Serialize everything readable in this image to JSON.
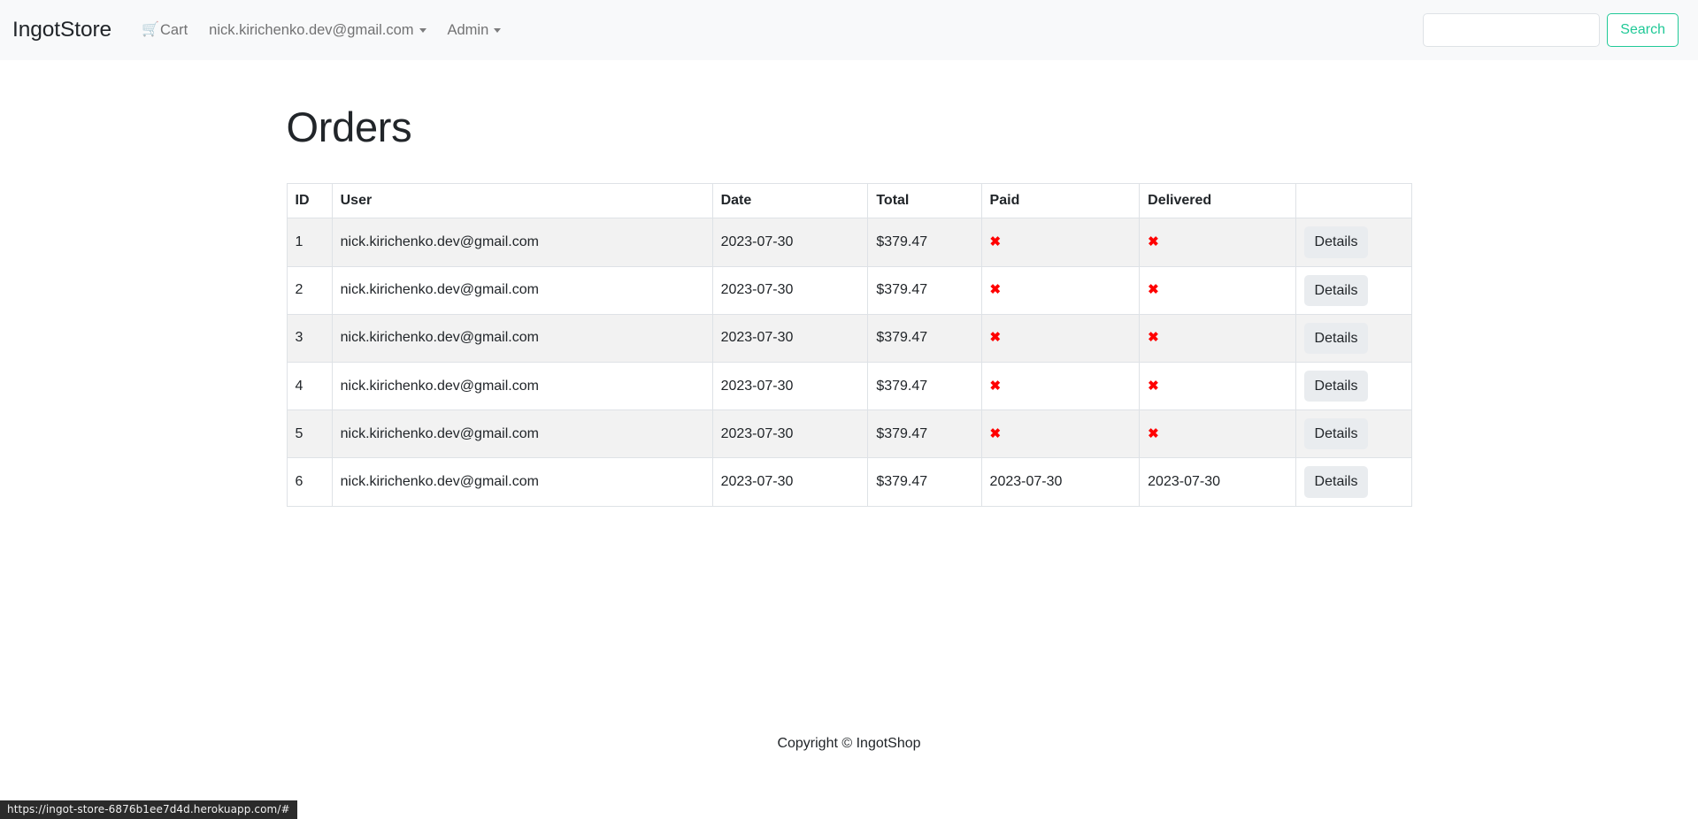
{
  "navbar": {
    "brand": "IngotStore",
    "links": [
      {
        "label": "Cart",
        "icon": "shopping-cart-icon",
        "has_caret": false
      },
      {
        "label": "nick.kirichenko.dev@gmail.com",
        "icon": null,
        "has_caret": true
      },
      {
        "label": "Admin",
        "icon": null,
        "has_caret": true
      }
    ],
    "search": {
      "value": "",
      "placeholder": "",
      "button_label": "Search",
      "accent_color": "#20c997"
    },
    "background_color": "#f8f9fa"
  },
  "main": {
    "title": "Orders",
    "table": {
      "columns": [
        "ID",
        "User",
        "Date",
        "Total",
        "Paid",
        "Delivered",
        ""
      ],
      "rows": [
        {
          "id": "1",
          "user": "nick.kirichenko.dev@gmail.com",
          "date": "2023-07-30",
          "total": "$379.47",
          "paid": "✖",
          "paid_is_date": false,
          "delivered": "✖",
          "delivered_is_date": false,
          "action": "Details"
        },
        {
          "id": "2",
          "user": "nick.kirichenko.dev@gmail.com",
          "date": "2023-07-30",
          "total": "$379.47",
          "paid": "✖",
          "paid_is_date": false,
          "delivered": "✖",
          "delivered_is_date": false,
          "action": "Details"
        },
        {
          "id": "3",
          "user": "nick.kirichenko.dev@gmail.com",
          "date": "2023-07-30",
          "total": "$379.47",
          "paid": "✖",
          "paid_is_date": false,
          "delivered": "✖",
          "delivered_is_date": false,
          "action": "Details"
        },
        {
          "id": "4",
          "user": "nick.kirichenko.dev@gmail.com",
          "date": "2023-07-30",
          "total": "$379.47",
          "paid": "✖",
          "paid_is_date": false,
          "delivered": "✖",
          "delivered_is_date": false,
          "action": "Details"
        },
        {
          "id": "5",
          "user": "nick.kirichenko.dev@gmail.com",
          "date": "2023-07-30",
          "total": "$379.47",
          "paid": "✖",
          "paid_is_date": false,
          "delivered": "✖",
          "delivered_is_date": false,
          "action": "Details"
        },
        {
          "id": "6",
          "user": "nick.kirichenko.dev@gmail.com",
          "date": "2023-07-30",
          "total": "$379.47",
          "paid": "2023-07-30",
          "paid_is_date": true,
          "delivered": "2023-07-30",
          "delivered_is_date": true,
          "action": "Details"
        }
      ]
    }
  },
  "footer": {
    "text": "Copyright © IngotShop"
  },
  "status_bar": {
    "url": "https://ingot-store-6876b1ee7d4d.herokuapp.com/#"
  },
  "colors": {
    "navbar_bg": "#f8f9fa",
    "accent": "#20c997",
    "danger": "#ff0000",
    "row_stripe": "#f2f2f2",
    "border": "#dee2e6",
    "button_bg": "#e9ecef"
  }
}
